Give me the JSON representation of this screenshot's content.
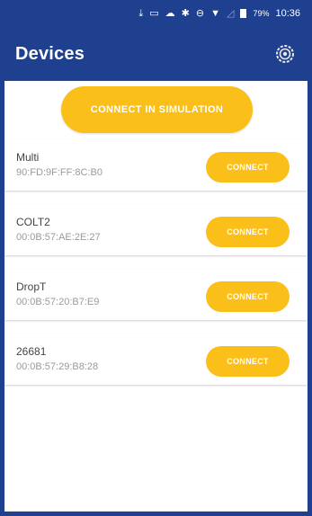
{
  "status_bar": {
    "icons": [
      "download-icon",
      "cast-icon",
      "cloud-icon",
      "bluetooth-icon",
      "do-not-disturb-icon",
      "wifi-icon",
      "signal-icon",
      "battery-icon"
    ],
    "battery": "79%",
    "time": "10:36"
  },
  "app_bar": {
    "title": "Devices",
    "settings_icon": "settings-icon"
  },
  "simulation_button": {
    "label": "CONNECT IN SIMULATION"
  },
  "devices": [
    {
      "name": "Multi",
      "mac": "90:FD:9F:FF:8C:B0",
      "connect_label": "CONNECT"
    },
    {
      "name": "COLT2",
      "mac": "00:0B:57:AE:2E:27",
      "connect_label": "CONNECT"
    },
    {
      "name": "DropT",
      "mac": "00:0B:57:20:B7:E9",
      "connect_label": "CONNECT"
    },
    {
      "name": "26681",
      "mac": "00:0B:57:29:B8:28",
      "connect_label": "CONNECT"
    }
  ],
  "colors": {
    "primary": "#1f3f8f",
    "accent": "#fbbf1a",
    "surface": "#ffffff"
  }
}
